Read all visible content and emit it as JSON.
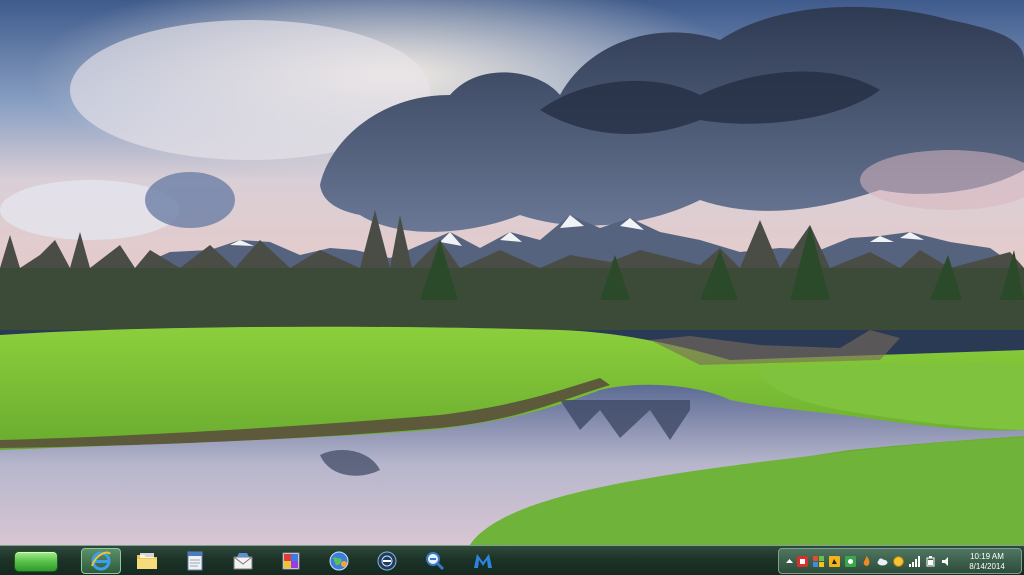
{
  "taskbar": {
    "start_label": "",
    "pinned": [
      {
        "name": "internet-explorer",
        "icon": "ie-icon",
        "active": true
      },
      {
        "name": "file-explorer",
        "icon": "folder-icon"
      },
      {
        "name": "notepad",
        "icon": "notepad-icon"
      },
      {
        "name": "mail",
        "icon": "mail-icon"
      },
      {
        "name": "paint-app",
        "icon": "paint-icon"
      },
      {
        "name": "globe-app",
        "icon": "globe-icon"
      },
      {
        "name": "media-center",
        "icon": "media-center-icon"
      },
      {
        "name": "search-app",
        "icon": "magnifier-icon"
      },
      {
        "name": "malwarebytes",
        "icon": "malwarebytes-icon"
      }
    ]
  },
  "tray": {
    "icons": [
      "expand-arrow-icon",
      "red-app-icon",
      "flag-icon",
      "yellow-app-icon",
      "green-app-icon",
      "flame-icon",
      "cloud-icon",
      "coin-icon",
      "signal-icon",
      "power-icon",
      "volume-icon"
    ],
    "time": "10:19 AM",
    "date": "8/14/2014"
  },
  "colors": {
    "taskbar": "#1d3328",
    "accent_green": "#58c14a"
  }
}
